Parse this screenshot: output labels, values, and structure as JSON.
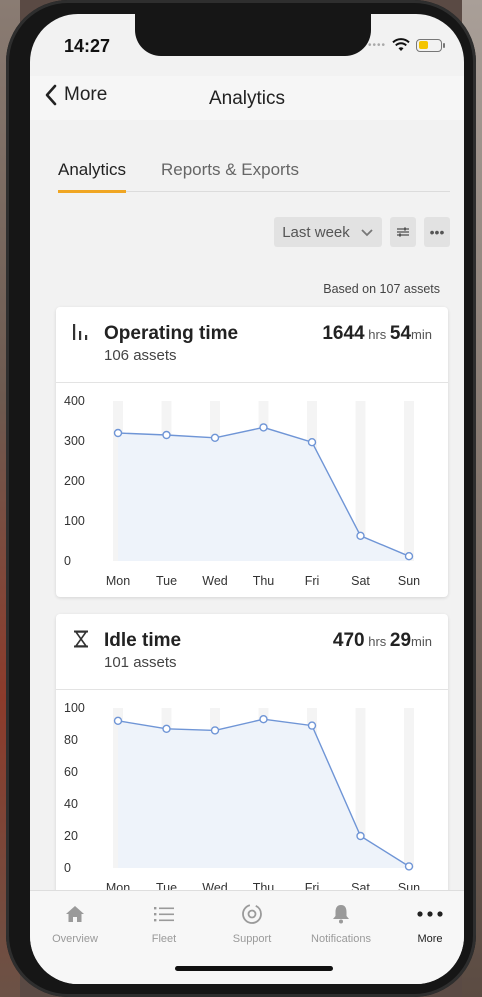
{
  "status_bar": {
    "time": "14:27"
  },
  "nav": {
    "back_label": "More",
    "title": "Analytics"
  },
  "tabs": [
    {
      "label": "Analytics",
      "active": true
    },
    {
      "label": "Reports & Exports",
      "active": false
    }
  ],
  "filters": {
    "period": "Last week"
  },
  "summary": {
    "based_on": "Based on 107 assets"
  },
  "cards": [
    {
      "title": "Operating time",
      "assets": "106 assets",
      "hours": "1644",
      "hours_unit": "hrs",
      "minutes": "54",
      "minutes_unit": "min",
      "icon": "bar-chart-icon"
    },
    {
      "title": "Idle time",
      "assets": "101 assets",
      "hours": "470",
      "hours_unit": "hrs",
      "minutes": "29",
      "minutes_unit": "min",
      "icon": "hourglass-icon"
    }
  ],
  "chart_data": [
    {
      "type": "area",
      "categories": [
        "Mon",
        "Tue",
        "Wed",
        "Thu",
        "Fri",
        "Sat",
        "Sun"
      ],
      "values": [
        320,
        315,
        308,
        334,
        297,
        63,
        12
      ],
      "yticks": [
        0,
        100,
        200,
        300,
        400
      ],
      "ylim": [
        0,
        400
      ],
      "accent": "#6f95d6",
      "fill": "#eef3fa"
    },
    {
      "type": "area",
      "categories": [
        "Mon",
        "Tue",
        "Wed",
        "Thu",
        "Fri",
        "Sat",
        "Sun"
      ],
      "values": [
        92,
        87,
        86,
        93,
        89,
        20,
        1
      ],
      "yticks": [
        0,
        20,
        40,
        60,
        80,
        100
      ],
      "ylim": [
        0,
        100
      ],
      "accent": "#6f95d6",
      "fill": "#eef3fa"
    }
  ],
  "tabbar": [
    {
      "label": "Overview",
      "icon": "home-icon",
      "active": false
    },
    {
      "label": "Fleet",
      "icon": "list-icon",
      "active": false
    },
    {
      "label": "Support",
      "icon": "support-icon",
      "active": false
    },
    {
      "label": "Notifications",
      "icon": "bell-icon",
      "active": false
    },
    {
      "label": "More",
      "icon": "more-icon",
      "active": true
    }
  ],
  "colors": {
    "accent_tab": "#f0a623",
    "chart_line": "#6f95d6"
  }
}
